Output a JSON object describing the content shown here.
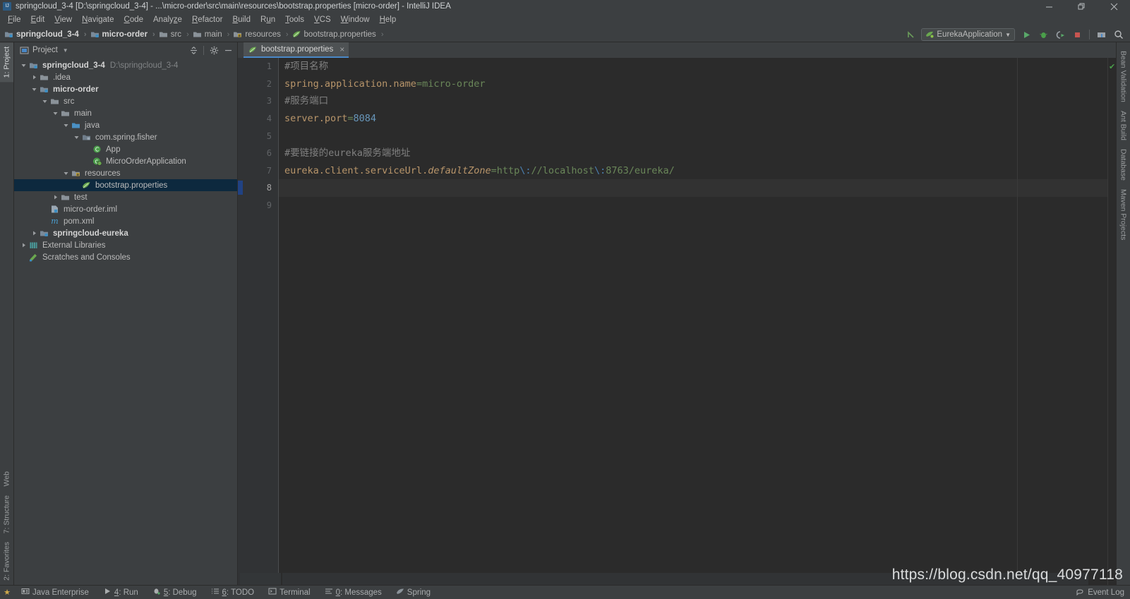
{
  "window": {
    "title": "springcloud_3-4 [D:\\springcloud_3-4] - ...\\micro-order\\src\\main\\resources\\bootstrap.properties [micro-order] - IntelliJ IDEA",
    "minimize_label": "minimize-icon",
    "restore_label": "restore-icon",
    "close_label": "close-icon"
  },
  "menubar": {
    "items": [
      {
        "label": "File",
        "mnemonic": "F"
      },
      {
        "label": "Edit",
        "mnemonic": "E"
      },
      {
        "label": "View",
        "mnemonic": "V"
      },
      {
        "label": "Navigate",
        "mnemonic": "N"
      },
      {
        "label": "Code",
        "mnemonic": "C"
      },
      {
        "label": "Analyze",
        "mnemonic": "z"
      },
      {
        "label": "Refactor",
        "mnemonic": "R"
      },
      {
        "label": "Build",
        "mnemonic": "B"
      },
      {
        "label": "Run",
        "mnemonic": "u"
      },
      {
        "label": "Tools",
        "mnemonic": "T"
      },
      {
        "label": "VCS",
        "mnemonic": "V"
      },
      {
        "label": "Window",
        "mnemonic": "W"
      },
      {
        "label": "Help",
        "mnemonic": "H"
      }
    ]
  },
  "navbar": {
    "crumbs": [
      {
        "label": "springcloud_3-4",
        "icon": "module-icon",
        "bold": true
      },
      {
        "label": "micro-order",
        "icon": "module-icon",
        "bold": true
      },
      {
        "label": "src",
        "icon": "folder-icon",
        "bold": false
      },
      {
        "label": "main",
        "icon": "folder-icon",
        "bold": false
      },
      {
        "label": "resources",
        "icon": "resources-folder-icon",
        "bold": false
      },
      {
        "label": "bootstrap.properties",
        "icon": "properties-file-icon",
        "bold": false
      }
    ],
    "run_config": "EurekaApplication",
    "buttons": [
      {
        "name": "make-project-icon"
      },
      {
        "name": "run-icon"
      },
      {
        "name": "debug-icon"
      },
      {
        "name": "run-with-coverage-icon"
      },
      {
        "name": "stop-icon"
      },
      {
        "name": "project-structure-icon"
      },
      {
        "name": "search-everywhere-icon"
      }
    ]
  },
  "left_strip": {
    "top": [
      {
        "label": "1: Project",
        "active": true
      }
    ],
    "bottom": [
      {
        "label": "Web"
      },
      {
        "label": "7: Structure"
      },
      {
        "label": "2: Favorites"
      }
    ]
  },
  "right_strip": {
    "items": [
      {
        "label": "Bean Validation",
        "icon": "bean-validation-icon"
      },
      {
        "label": "Ant Build",
        "icon": "ant-icon"
      },
      {
        "label": "Database",
        "icon": "database-icon"
      },
      {
        "label": "Maven Projects",
        "icon": "maven-icon"
      }
    ]
  },
  "project_pane": {
    "title": "Project",
    "actions": [
      {
        "name": "collapse-all-icon"
      },
      {
        "name": "gear-icon"
      },
      {
        "name": "hide-icon"
      }
    ],
    "tree": [
      {
        "indent": 0,
        "arrow": "down",
        "icon": "module-icon",
        "label": "springcloud_3-4",
        "bold": true,
        "path": "D:\\springcloud_3-4",
        "selected": false
      },
      {
        "indent": 1,
        "arrow": "right",
        "icon": "folder-icon",
        "label": ".idea",
        "bold": false,
        "path": "",
        "selected": false
      },
      {
        "indent": 1,
        "arrow": "down",
        "icon": "module-icon",
        "label": "micro-order",
        "bold": true,
        "path": "",
        "selected": false
      },
      {
        "indent": 2,
        "arrow": "down",
        "icon": "folder-icon",
        "label": "src",
        "bold": false,
        "path": "",
        "selected": false
      },
      {
        "indent": 3,
        "arrow": "down",
        "icon": "folder-icon",
        "label": "main",
        "bold": false,
        "path": "",
        "selected": false
      },
      {
        "indent": 4,
        "arrow": "down",
        "icon": "source-folder-icon",
        "label": "java",
        "bold": false,
        "path": "",
        "selected": false
      },
      {
        "indent": 5,
        "arrow": "down",
        "icon": "package-icon",
        "label": "com.spring.fisher",
        "bold": false,
        "path": "",
        "selected": false
      },
      {
        "indent": 6,
        "arrow": "none",
        "icon": "class-icon",
        "label": "App",
        "bold": false,
        "path": "",
        "selected": false
      },
      {
        "indent": 6,
        "arrow": "none",
        "icon": "spring-class-icon",
        "label": "MicroOrderApplication",
        "bold": false,
        "path": "",
        "selected": false
      },
      {
        "indent": 4,
        "arrow": "down",
        "icon": "resources-folder-icon",
        "label": "resources",
        "bold": false,
        "path": "",
        "selected": false
      },
      {
        "indent": 5,
        "arrow": "none",
        "icon": "properties-file-icon",
        "label": "bootstrap.properties",
        "bold": false,
        "path": "",
        "selected": true
      },
      {
        "indent": 3,
        "arrow": "right",
        "icon": "folder-icon",
        "label": "test",
        "bold": false,
        "path": "",
        "selected": false
      },
      {
        "indent": 2,
        "arrow": "none",
        "icon": "iml-file-icon",
        "label": "micro-order.iml",
        "bold": false,
        "path": "",
        "selected": false
      },
      {
        "indent": 2,
        "arrow": "none",
        "icon": "maven-file-icon",
        "label": "pom.xml",
        "bold": false,
        "path": "",
        "selected": false
      },
      {
        "indent": 1,
        "arrow": "right",
        "icon": "module-icon",
        "label": "springcloud-eureka",
        "bold": true,
        "path": "",
        "selected": false
      },
      {
        "indent": 0,
        "arrow": "right",
        "icon": "libraries-icon",
        "label": "External Libraries",
        "bold": false,
        "path": "",
        "selected": false
      },
      {
        "indent": 0,
        "arrow": "none",
        "icon": "scratches-icon",
        "label": "Scratches and Consoles",
        "bold": false,
        "path": "",
        "selected": false
      }
    ]
  },
  "editor": {
    "tab": {
      "label": "bootstrap.properties",
      "icon": "properties-file-icon",
      "close": "×"
    },
    "current_line": 8,
    "lines": [
      {
        "num": 1,
        "tokens": [
          {
            "t": "comment",
            "v": "#项目名称"
          }
        ]
      },
      {
        "num": 2,
        "tokens": [
          {
            "t": "key",
            "v": "spring.application.name"
          },
          {
            "t": "eq",
            "v": "="
          },
          {
            "t": "val",
            "v": "micro-order"
          }
        ]
      },
      {
        "num": 3,
        "tokens": [
          {
            "t": "comment",
            "v": "#服务端口"
          }
        ]
      },
      {
        "num": 4,
        "tokens": [
          {
            "t": "key",
            "v": "server.port"
          },
          {
            "t": "eq",
            "v": "="
          },
          {
            "t": "num",
            "v": "8084"
          }
        ]
      },
      {
        "num": 5,
        "tokens": []
      },
      {
        "num": 6,
        "tokens": [
          {
            "t": "comment",
            "v": "#要链接的eureka服务端地址"
          }
        ]
      },
      {
        "num": 7,
        "tokens": [
          {
            "t": "key",
            "v": "eureka.client.serviceUrl."
          },
          {
            "t": "key-i",
            "v": "defaultZone"
          },
          {
            "t": "eq",
            "v": "="
          },
          {
            "t": "val",
            "v": "http"
          },
          {
            "t": "esc",
            "v": "\\:"
          },
          {
            "t": "val",
            "v": "//localhost"
          },
          {
            "t": "esc",
            "v": "\\:"
          },
          {
            "t": "val",
            "v": "8763/eureka/"
          }
        ]
      },
      {
        "num": 8,
        "tokens": []
      },
      {
        "num": 9,
        "tokens": []
      }
    ]
  },
  "bottom_bar": {
    "items": [
      {
        "label": "Java Enterprise",
        "mnemonic": "",
        "icon": "java-enterprise-icon"
      },
      {
        "label": "4: Run",
        "mnemonic": "4",
        "icon": "run-icon"
      },
      {
        "label": "5: Debug",
        "mnemonic": "5",
        "icon": "debug-icon"
      },
      {
        "label": "6: TODO",
        "mnemonic": "6",
        "icon": "todo-icon"
      },
      {
        "label": "Terminal",
        "mnemonic": "",
        "icon": "terminal-icon"
      },
      {
        "label": "0: Messages",
        "mnemonic": "0",
        "icon": "messages-icon"
      },
      {
        "label": "Spring",
        "mnemonic": "",
        "icon": "spring-icon"
      }
    ],
    "event_log": "Event Log"
  },
  "watermark": "https://blog.csdn.net/qq_40977118",
  "colors": {
    "bg_chrome": "#3c3f41",
    "bg_editor": "#2b2b2b",
    "bg_gutter": "#313335",
    "selection": "#0d293e",
    "tab_active_underline": "#4a88c7",
    "key": "#b8956a",
    "value": "#6a8759",
    "number": "#6897bb",
    "comment": "#808080",
    "escape": "#4a7fb0"
  }
}
